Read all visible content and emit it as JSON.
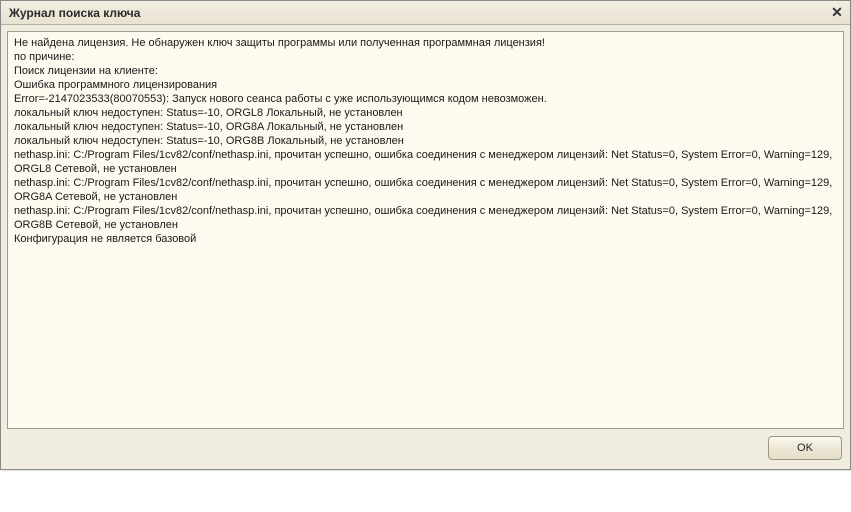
{
  "titlebar": {
    "title": "Журнал поиска ключа"
  },
  "log": {
    "lines": [
      "Не найдена лицензия. Не обнаружен ключ защиты программы или полученная программная лицензия!",
      "по причине:",
      "Поиск лицензии на клиенте:",
      "Ошибка программного лицензирования",
      "Error=-2147023533(80070553): Запуск нового сеанса работы с уже использующимся кодом невозможен.",
      "локальный ключ недоступен: Status=-10, ORGL8 Локальный, не установлен",
      "локальный ключ недоступен: Status=-10, ORG8A Локальный, не установлен",
      "локальный ключ недоступен: Status=-10, ORG8B Локальный, не установлен",
      "nethasp.ini: C:/Program Files/1cv82/conf/nethasp.ini, прочитан успешно, ошибка соединения с менеджером лицензий: Net Status=0, System Error=0, Warning=129, ORGL8 Сетевой, не установлен",
      "nethasp.ini: C:/Program Files/1cv82/conf/nethasp.ini, прочитан успешно, ошибка соединения с менеджером лицензий: Net Status=0, System Error=0, Warning=129, ORG8A Сетевой, не установлен",
      "nethasp.ini: C:/Program Files/1cv82/conf/nethasp.ini, прочитан успешно, ошибка соединения с менеджером лицензий: Net Status=0, System Error=0, Warning=129, ORG8B Сетевой, не установлен",
      "Конфигурация не является базовой"
    ]
  },
  "buttons": {
    "ok_label": "OK"
  }
}
